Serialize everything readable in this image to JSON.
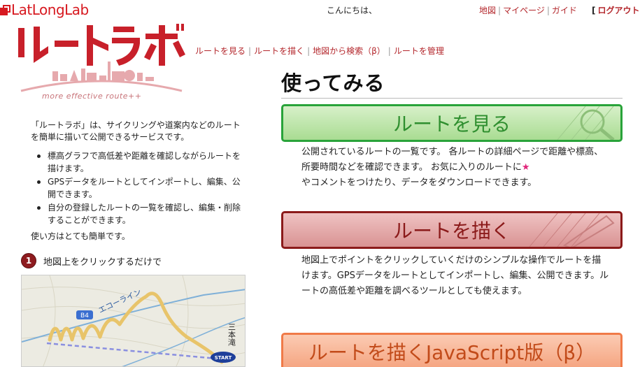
{
  "header": {
    "brand": "LatLongLab",
    "greeting": "こんにちは、",
    "links": [
      "地図",
      "マイページ",
      "ガイド"
    ],
    "logout": "ログアウト",
    "bracket": "["
  },
  "logo": {
    "title": "ルートラボ",
    "tagline": "more effective route++"
  },
  "subnav": [
    "ルートを見る",
    "ルートを描く",
    "地図から検索（β）",
    "ルートを管理"
  ],
  "intro": {
    "text": "「ルートラボ」は、サイクリングや道案内などのルートを簡単に描いて公開できるサービスです。",
    "bullets": [
      "標高グラフで高低差や距離を確認しながらルートを描けます。",
      "GPSデータをルートとしてインポートし、編集、公開できます。",
      "自分の登録したルートの一覧を確認し、編集・削除することができます。"
    ],
    "simple": "使い方はとても簡単です。"
  },
  "step": {
    "number": "1",
    "text": "地図上をクリックするだけで"
  },
  "map": {
    "road_name": "エコーライン",
    "route_number": "B4",
    "place": "三本滝",
    "marker": "START"
  },
  "main": {
    "heading": "使ってみる",
    "view": {
      "button": "ルートを見る",
      "desc_before_star": "公開されているルートの一覧です。 各ルートの詳細ページで距離や標高、所要時間などを確認できます。 お気に入りのルートに",
      "star": "★",
      "desc_after_star": "やコメントをつけたり、データをダウンロードできます。"
    },
    "draw": {
      "button": "ルートを描く",
      "desc": "地図上でポイントをクリックしていくだけのシンプルな操作でルートを描けます。GPSデータをルートとしてインポートし、編集、公開できます。ルートの高低差や距離を調べるツールとしても使えます。"
    },
    "js": {
      "button": "ルートを描くJavaScript版（β）"
    }
  },
  "colors": {
    "brand_red": "#d71920",
    "link_red": "#b3262b",
    "view_green": "#29a33a",
    "draw_maroon": "#8b1a1a",
    "js_orange": "#f07a48",
    "star_pink": "#e0257a"
  }
}
